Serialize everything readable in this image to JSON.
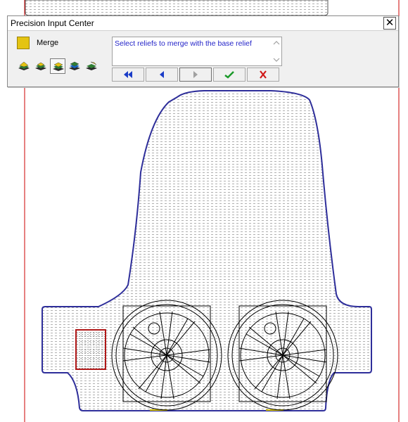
{
  "window": {
    "title": "Precision Input Center",
    "close_glyph": "✕"
  },
  "tool": {
    "name": "Merge",
    "swatch_color": "#e4c412"
  },
  "mode_buttons": [
    {
      "icon": "relief-mode-1-icon",
      "selected": false
    },
    {
      "icon": "relief-mode-2-icon",
      "selected": false
    },
    {
      "icon": "relief-merge-mode-icon",
      "selected": true
    },
    {
      "icon": "relief-mode-4-icon",
      "selected": false
    },
    {
      "icon": "relief-mode-5-icon",
      "selected": false
    }
  ],
  "prompt": {
    "text": "Select reliefs to merge with the base relief",
    "color": "#2424c8"
  },
  "nav_buttons": [
    {
      "icon": "rewind-icon",
      "enabled": true
    },
    {
      "icon": "back-icon",
      "enabled": true
    },
    {
      "icon": "forward-icon",
      "enabled": false
    },
    {
      "icon": "accept-check-icon",
      "enabled": true
    },
    {
      "icon": "cancel-x-icon",
      "enabled": true
    }
  ],
  "drawing": {
    "outline_color": "#2e2e9a",
    "guide_line_color": "#cc0000",
    "selected_relief_color": "#b01818",
    "wheel_count": 2,
    "wheel_spokes": 8
  }
}
